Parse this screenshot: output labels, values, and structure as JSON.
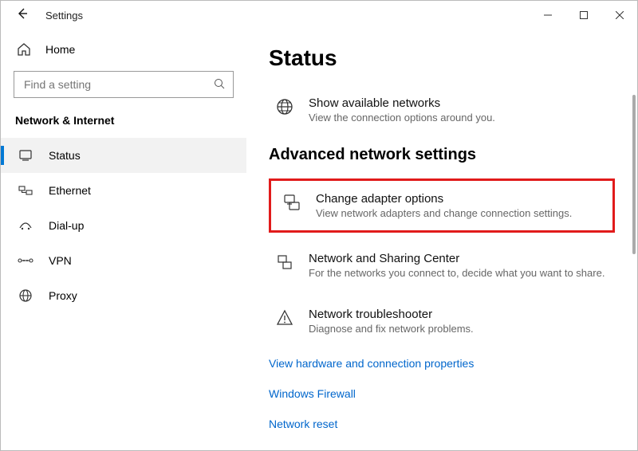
{
  "window": {
    "title": "Settings"
  },
  "sidebar": {
    "home": "Home",
    "search_placeholder": "Find a setting",
    "category": "Network & Internet",
    "items": [
      {
        "label": "Status"
      },
      {
        "label": "Ethernet"
      },
      {
        "label": "Dial-up"
      },
      {
        "label": "VPN"
      },
      {
        "label": "Proxy"
      }
    ]
  },
  "main": {
    "page_title": "Status",
    "show_networks": {
      "title": "Show available networks",
      "sub": "View the connection options around you."
    },
    "section_title": "Advanced network settings",
    "adapter": {
      "title": "Change adapter options",
      "sub": "View network adapters and change connection settings."
    },
    "sharing": {
      "title": "Network and Sharing Center",
      "sub": "For the networks you connect to, decide what you want to share."
    },
    "troubleshooter": {
      "title": "Network troubleshooter",
      "sub": "Diagnose and fix network problems."
    },
    "links": {
      "hardware": "View hardware and connection properties",
      "firewall": "Windows Firewall",
      "reset": "Network reset"
    }
  }
}
